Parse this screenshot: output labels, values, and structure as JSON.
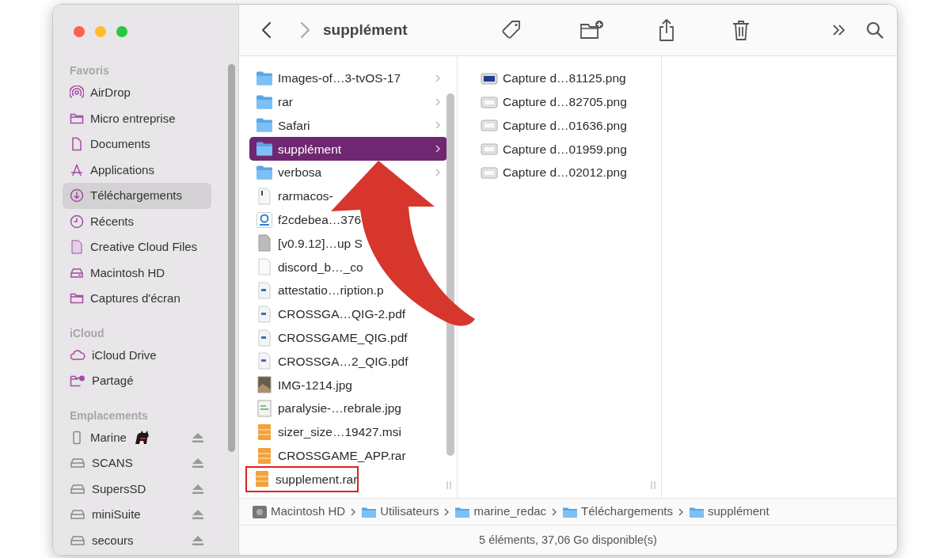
{
  "window": {
    "title": "supplément"
  },
  "sidebar": {
    "sections": [
      {
        "title": "Favoris",
        "items": [
          {
            "label": "AirDrop",
            "kind": "airdrop",
            "selected": false
          },
          {
            "label": "Micro entreprise",
            "kind": "folder",
            "selected": false
          },
          {
            "label": "Documents",
            "kind": "document",
            "selected": false
          },
          {
            "label": "Applications",
            "kind": "apps",
            "selected": false
          },
          {
            "label": "Téléchargements",
            "kind": "download",
            "selected": true
          },
          {
            "label": "Récents",
            "kind": "clock",
            "selected": false
          },
          {
            "label": "Creative Cloud Files",
            "kind": "filledfile",
            "selected": false
          },
          {
            "label": "Macintosh HD",
            "kind": "drive",
            "selected": false
          },
          {
            "label": "Captures d'écran",
            "kind": "folder",
            "selected": false
          }
        ]
      },
      {
        "title": "iCloud",
        "items": [
          {
            "label": "iCloud Drive",
            "kind": "cloud",
            "selected": false
          },
          {
            "label": "Partagé",
            "kind": "shared",
            "selected": false
          }
        ]
      },
      {
        "title": "Emplacements",
        "items": [
          {
            "label": "Marine",
            "kind": "device",
            "selected": false,
            "ejectable": true
          },
          {
            "label": "SCANS",
            "kind": "disk",
            "selected": false,
            "ejectable": true
          },
          {
            "label": "SupersSD",
            "kind": "disk",
            "selected": false,
            "ejectable": true
          },
          {
            "label": "miniSuite",
            "kind": "disk",
            "selected": false,
            "ejectable": true
          },
          {
            "label": "secours",
            "kind": "disk",
            "selected": false,
            "ejectable": true
          }
        ]
      }
    ]
  },
  "columns": [
    {
      "items": [
        {
          "name": "Images-of…3-tvOS-17",
          "kind": "folder",
          "selected": false
        },
        {
          "name": "rar",
          "kind": "folder",
          "selected": false
        },
        {
          "name": "Safari",
          "kind": "folder",
          "selected": false
        },
        {
          "name": "supplément",
          "kind": "folder",
          "selected": true
        },
        {
          "name": "verbosa",
          "kind": "folder",
          "selected": false
        },
        {
          "name": "rarmacos-",
          "kind": "exec",
          "selected": false
        },
        {
          "name": "f2cdebea…376",
          "kind": "app",
          "selected": false
        },
        {
          "name": "[v0.9.12]…up S",
          "kind": "greydoc",
          "selected": false
        },
        {
          "name": "discord_b…_co",
          "kind": "blank",
          "selected": false
        },
        {
          "name": "attestatio…ription.p",
          "kind": "pdf",
          "selected": false
        },
        {
          "name": "CROSSGA…QIG-2.pdf",
          "kind": "pdf",
          "selected": false
        },
        {
          "name": "CROSSGAME_QIG.pdf",
          "kind": "pdf",
          "selected": false
        },
        {
          "name": "CROSSGA…2_QIG.pdf",
          "kind": "pdf",
          "selected": false
        },
        {
          "name": "IMG-1214.jpg",
          "kind": "photo",
          "selected": false
        },
        {
          "name": "paralysie-…rebrale.jpg",
          "kind": "image",
          "selected": false
        },
        {
          "name": "sizer_size…19427.msi",
          "kind": "archive",
          "selected": false
        },
        {
          "name": "CROSSGAME_APP.rar",
          "kind": "archive",
          "selected": false
        },
        {
          "name": "supplement.rar",
          "kind": "archive",
          "selected": false,
          "highlighted": true
        }
      ]
    },
    {
      "items": [
        {
          "name": "Capture d…81125.png",
          "kind": "shot-dark",
          "selected": false
        },
        {
          "name": "Capture d…82705.png",
          "kind": "shot",
          "selected": false
        },
        {
          "name": "Capture d…01636.png",
          "kind": "shot",
          "selected": false
        },
        {
          "name": "Capture d…01959.png",
          "kind": "shot",
          "selected": false
        },
        {
          "name": "Capture d…02012.png",
          "kind": "shot",
          "selected": false
        }
      ]
    }
  ],
  "path_bar": [
    {
      "label": "Macintosh HD",
      "kind": "disk"
    },
    {
      "label": "Utilisateurs",
      "kind": "folder"
    },
    {
      "label": "marine_redac",
      "kind": "folder"
    },
    {
      "label": "Téléchargements",
      "kind": "folder"
    },
    {
      "label": "supplément",
      "kind": "folder"
    }
  ],
  "status_bar": "5 éléments, 37,06 Go disponible(s)"
}
